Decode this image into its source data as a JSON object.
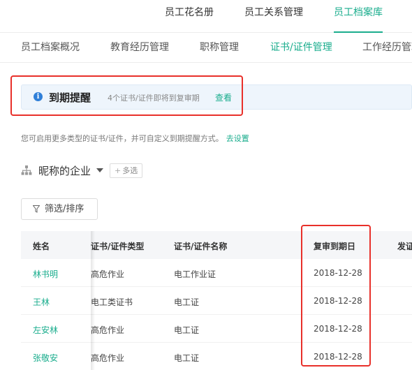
{
  "top_tabs": [
    {
      "label": "员工花名册",
      "active": false
    },
    {
      "label": "员工关系管理",
      "active": false
    },
    {
      "label": "员工档案库",
      "active": true
    }
  ],
  "sub_tabs": [
    {
      "label": "员工档案概况",
      "active": false
    },
    {
      "label": "教育经历管理",
      "active": false
    },
    {
      "label": "职称管理",
      "active": false
    },
    {
      "label": "证书/证件管理",
      "active": true
    },
    {
      "label": "工作经历管理",
      "active": false
    }
  ],
  "alert": {
    "icon": "info-icon",
    "title": "到期提醒",
    "description": "4个证书/证件即将到复审期",
    "link": "查看"
  },
  "hint": {
    "text": "您可启用更多类型的证书/证件，并可自定义到期提醒方式。",
    "link": "去设置"
  },
  "org": {
    "icon": "org-tree-icon",
    "name": "昵称的企业",
    "multi_select_label": "多选"
  },
  "filter": {
    "icon": "funnel-icon",
    "label": "筛选/排序"
  },
  "table": {
    "columns": [
      "姓名",
      "证书/证件类型",
      "证书/证件名称",
      "复审到期日",
      "发证"
    ],
    "rows": [
      {
        "name": "林书明",
        "type": "高危作业",
        "cert_name": "电工作业证",
        "review_date": "2018-12-28"
      },
      {
        "name": "王林",
        "type": "电工类证书",
        "cert_name": "电工证",
        "review_date": "2018-12-28"
      },
      {
        "name": "左安林",
        "type": "高危作业",
        "cert_name": "电工证",
        "review_date": "2018-12-28"
      },
      {
        "name": "张敬安",
        "type": "高危作业",
        "cert_name": "电工证",
        "review_date": "2018-12-28"
      }
    ]
  },
  "colors": {
    "accent": "#1aad8d",
    "highlight_border": "#e8302a",
    "alert_bg": "#eef5fc",
    "info_icon": "#2f7fd8"
  }
}
